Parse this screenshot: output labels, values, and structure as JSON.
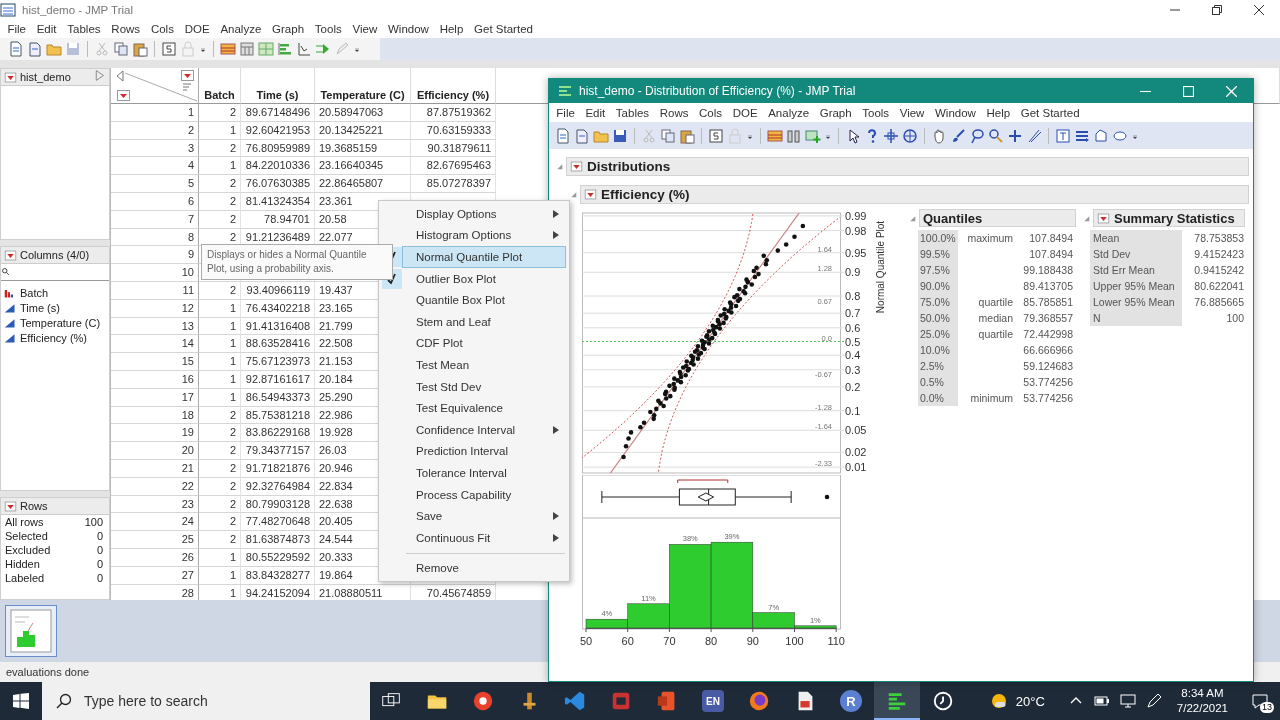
{
  "main_window": {
    "title": "hist_demo - JMP Trial",
    "menu": [
      "File",
      "Edit",
      "Tables",
      "Rows",
      "Cols",
      "DOE",
      "Analyze",
      "Graph",
      "Tools",
      "View",
      "Window",
      "Help",
      "Get Started"
    ]
  },
  "table_panel": {
    "title": "hist_demo"
  },
  "columns_panel": {
    "title": "Columns (4/0)",
    "columns": [
      {
        "name": "Batch",
        "kind": "nominal"
      },
      {
        "name": "Time (s)",
        "kind": "continuous"
      },
      {
        "name": "Temperature (C)",
        "kind": "continuous"
      },
      {
        "name": "Efficiency (%)",
        "kind": "continuous"
      }
    ]
  },
  "rows_panel": {
    "title": "Rows",
    "rows": [
      {
        "label": "All rows",
        "count": "100"
      },
      {
        "label": "Selected",
        "count": "0"
      },
      {
        "label": "Excluded",
        "count": "0"
      },
      {
        "label": "Hidden",
        "count": "0"
      },
      {
        "label": "Labeled",
        "count": "0"
      }
    ]
  },
  "grid": {
    "columns": [
      "Batch",
      "Time (s)",
      "Temperature (C)",
      "Efficiency (%)"
    ],
    "rows": [
      {
        "n": "1",
        "cells": [
          "2",
          "89.67148496",
          "20.58947063",
          "87.87519362"
        ]
      },
      {
        "n": "2",
        "cells": [
          "1",
          "92.60421953",
          "20.13425221",
          "70.63159333"
        ]
      },
      {
        "n": "3",
        "cells": [
          "2",
          "76.80959989",
          "19.3685159",
          "90.31879611"
        ]
      },
      {
        "n": "4",
        "cells": [
          "1",
          "84.22010336",
          "23.16640345",
          "82.67695463"
        ]
      },
      {
        "n": "5",
        "cells": [
          "2",
          "76.07630385",
          "22.86465807",
          "85.07278397"
        ]
      },
      {
        "n": "6",
        "cells": [
          "2",
          "81.41324354",
          "23.361"
        ]
      },
      {
        "n": "7",
        "cells": [
          "2",
          "78.94701",
          "20.58"
        ]
      },
      {
        "n": "8",
        "cells": [
          "2",
          "91.21236489",
          "22.077"
        ]
      },
      {
        "n": "9"
      },
      {
        "n": "10"
      },
      {
        "n": "11",
        "cells": [
          "2",
          "93.40966119",
          "19.437"
        ]
      },
      {
        "n": "12",
        "cells": [
          "1",
          "76.43402218",
          "23.165"
        ]
      },
      {
        "n": "13",
        "cells": [
          "1",
          "91.41316408",
          "21.799"
        ]
      },
      {
        "n": "14",
        "cells": [
          "1",
          "88.63528416",
          "22.508"
        ]
      },
      {
        "n": "15",
        "cells": [
          "1",
          "75.67123973",
          "21.153"
        ]
      },
      {
        "n": "16",
        "cells": [
          "1",
          "92.87161617",
          "20.184"
        ]
      },
      {
        "n": "17",
        "cells": [
          "1",
          "86.54943373",
          "25.290"
        ]
      },
      {
        "n": "18",
        "cells": [
          "2",
          "85.75381218",
          "22.986"
        ]
      },
      {
        "n": "19",
        "cells": [
          "2",
          "83.86229168",
          "19.928"
        ]
      },
      {
        "n": "20",
        "cells": [
          "2",
          "79.34377157",
          "26.03"
        ]
      },
      {
        "n": "21",
        "cells": [
          "2",
          "91.71821876",
          "20.946"
        ]
      },
      {
        "n": "22",
        "cells": [
          "2",
          "92.32764984",
          "22.834"
        ]
      },
      {
        "n": "23",
        "cells": [
          "2",
          "80.79903128",
          "22.638"
        ]
      },
      {
        "n": "24",
        "cells": [
          "2",
          "77.48270648",
          "20.405"
        ]
      },
      {
        "n": "25",
        "cells": [
          "2",
          "81.63874873",
          "24.544"
        ]
      },
      {
        "n": "26",
        "cells": [
          "1",
          "80.55229592",
          "20.333"
        ]
      },
      {
        "n": "27",
        "cells": [
          "1",
          "83.84328277",
          "19.864"
        ]
      },
      {
        "n": "28",
        "cells": [
          "1",
          "94.24152094",
          "21.08880511",
          "70.45674859"
        ]
      }
    ]
  },
  "status_bar": "evaluations done",
  "dist_window": {
    "title": "hist_demo - Distribution of Efficiency (%) - JMP Trial",
    "menu": [
      "File",
      "Edit",
      "Tables",
      "Rows",
      "Cols",
      "DOE",
      "Analyze",
      "Graph",
      "Tools",
      "View",
      "Window",
      "Help",
      "Get Started"
    ],
    "outline": "Distributions",
    "variable": "Efficiency (%)",
    "quantile_plot": {
      "title": "Normal Quantile Plot",
      "probability_ticks": [
        "0.99",
        "0.98",
        "0.95",
        "0.9",
        "0.8",
        "0.7",
        "0.6",
        "0.5",
        "0.4",
        "0.3",
        "0.2",
        "0.1",
        "0.05",
        "0.02",
        "0.01"
      ],
      "z_ticks": [
        "1.64",
        "1.28",
        "0.67",
        "0.0",
        "-0.67",
        "-1.28",
        "-1.64",
        "-2.33"
      ]
    },
    "histogram": {
      "chart_data": {
        "type": "bar",
        "x": [
          55,
          65,
          75,
          85,
          95,
          105
        ],
        "values": [
          4,
          11,
          38,
          39,
          7,
          1
        ],
        "xlim": [
          50,
          110
        ],
        "xticks": [
          50,
          60,
          70,
          80,
          90,
          100,
          110
        ],
        "value_labels": [
          "4%",
          "11%",
          "38%",
          "39%",
          "7%",
          "1%"
        ]
      }
    },
    "quantiles": {
      "title": "Quantiles",
      "rows": [
        {
          "pct": "100.0%",
          "label": "maximum",
          "value": "107.8494"
        },
        {
          "pct": "99.5%",
          "value": "107.8494"
        },
        {
          "pct": "97.5%",
          "value": "99.188438"
        },
        {
          "pct": "90.0%",
          "value": "89.413705"
        },
        {
          "pct": "75.0%",
          "label": "quartile",
          "value": "85.785851"
        },
        {
          "pct": "50.0%",
          "label": "median",
          "value": "79.368557"
        },
        {
          "pct": "25.0%",
          "label": "quartile",
          "value": "72.442998"
        },
        {
          "pct": "10.0%",
          "value": "66.666966"
        },
        {
          "pct": "2.5%",
          "value": "59.124683"
        },
        {
          "pct": "0.5%",
          "value": "53.774256"
        },
        {
          "pct": "0.0%",
          "label": "minimum",
          "value": "53.774256"
        }
      ]
    },
    "summary": {
      "title": "Summary Statistics",
      "rows": [
        {
          "label": "Mean",
          "value": "78.753853"
        },
        {
          "label": "Std Dev",
          "value": "9.4152423"
        },
        {
          "label": "Std Err Mean",
          "value": "0.9415242"
        },
        {
          "label": "Upper 95% Mean",
          "value": "80.622041"
        },
        {
          "label": "Lower 95% Mean",
          "value": "76.885665"
        },
        {
          "label": "N",
          "value": "100"
        }
      ]
    }
  },
  "context_menu": {
    "groups": [
      [
        {
          "label": "Display Options",
          "submenu": true,
          "checked": false,
          "selected": false
        },
        {
          "label": "Histogram Options",
          "submenu": true,
          "checked": false,
          "selected": false
        },
        {
          "label": "Normal Quantile Plot",
          "submenu": false,
          "checked": true,
          "selected": true
        },
        {
          "label": "Outlier Box Plot",
          "submenu": false,
          "checked": true,
          "selected": false
        },
        {
          "label": "Quantile Box Plot",
          "submenu": false,
          "checked": false,
          "selected": false
        },
        {
          "label": "Stem and Leaf",
          "submenu": false,
          "checked": false,
          "selected": false
        },
        {
          "label": "CDF Plot",
          "submenu": false,
          "checked": false,
          "selected": false
        },
        {
          "label": "Test Mean",
          "submenu": false,
          "checked": false,
          "selected": false
        },
        {
          "label": "Test Std Dev",
          "submenu": false,
          "checked": false,
          "selected": false
        },
        {
          "label": "Test Equivalence",
          "submenu": false,
          "checked": false,
          "selected": false
        },
        {
          "label": "Confidence Interval",
          "submenu": true,
          "checked": false,
          "selected": false
        },
        {
          "label": "Prediction Interval",
          "submenu": false,
          "checked": false,
          "selected": false
        },
        {
          "label": "Tolerance Interval",
          "submenu": false,
          "checked": false,
          "selected": false
        },
        {
          "label": "Process Capability",
          "submenu": false,
          "checked": false,
          "selected": false
        },
        {
          "label": "Save",
          "submenu": true,
          "checked": false,
          "selected": false
        },
        {
          "label": "Continuous Fit",
          "submenu": true,
          "checked": false,
          "selected": false
        }
      ],
      [
        {
          "label": "Remove",
          "submenu": false,
          "checked": false,
          "selected": false
        }
      ]
    ]
  },
  "tooltip": "Displays or hides a Normal Quantile Plot, using a probability axis.",
  "taskbar": {
    "search": {
      "placeholder": "Type here to search"
    },
    "apps": [
      {
        "kind": "taskview",
        "active": false
      },
      {
        "kind": "explorer",
        "active": false
      },
      {
        "kind": "redcircle",
        "active": false
      },
      {
        "kind": "gold",
        "active": false
      },
      {
        "kind": "vscode",
        "active": false
      },
      {
        "kind": "redbox",
        "active": false
      },
      {
        "kind": "office",
        "active": false
      },
      {
        "kind": "badge",
        "label": "EN",
        "active": false
      },
      {
        "kind": "firefox",
        "active": false
      },
      {
        "kind": "pdf",
        "active": false
      },
      {
        "kind": "round",
        "label": "R",
        "active": false
      },
      {
        "kind": "jmp",
        "active": true
      },
      {
        "kind": "clock",
        "active": false
      }
    ],
    "weather": "20°C",
    "time": "8:34 AM",
    "date": "7/22/2021",
    "notifications": "13"
  }
}
